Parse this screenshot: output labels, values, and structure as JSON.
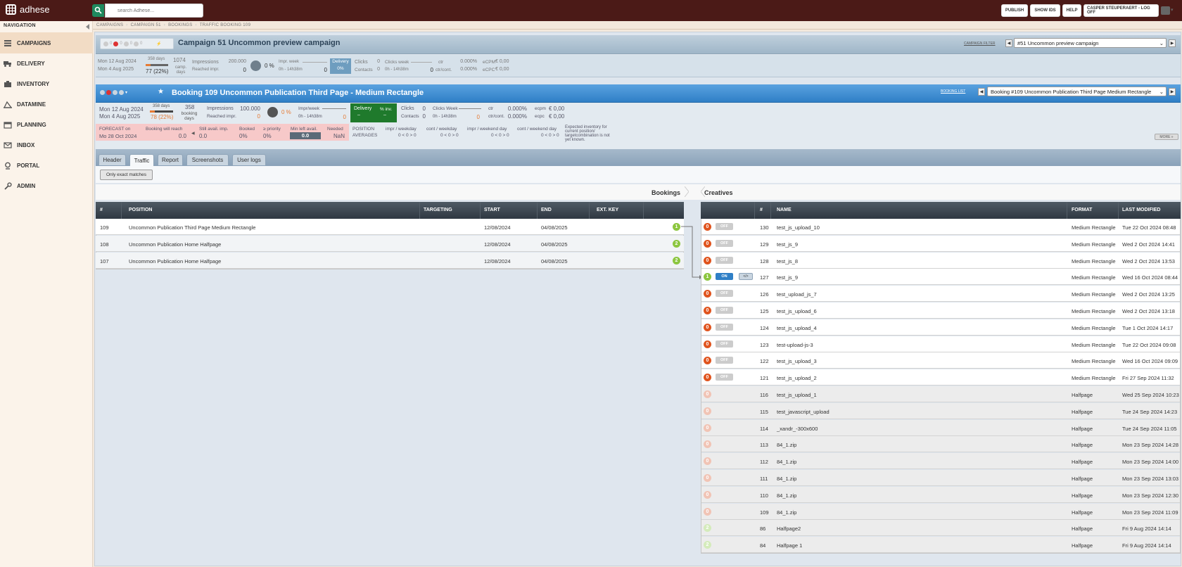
{
  "app": {
    "logo_text": "adhese",
    "search_placeholder": "search Adhese..."
  },
  "topbar": {
    "publish": "PUBLISH",
    "show_ids": "SHOW IDS",
    "help": "HELP",
    "user": "CASPER STEUPERAERT - LOG OFF"
  },
  "nav": {
    "title": "NAVIGATION",
    "items": [
      {
        "label": "CAMPAIGNS",
        "icon": "campaigns-icon"
      },
      {
        "label": "DELIVERY",
        "icon": "truck-icon"
      },
      {
        "label": "INVENTORY",
        "icon": "inventory-icon"
      },
      {
        "label": "DATAMINE",
        "icon": "datamine-icon"
      },
      {
        "label": "PLANNING",
        "icon": "calendar-icon"
      },
      {
        "label": "INBOX",
        "icon": "mail-icon"
      },
      {
        "label": "PORTAL",
        "icon": "portal-icon"
      },
      {
        "label": "ADMIN",
        "icon": "wrench-icon"
      }
    ]
  },
  "breadcrumb": [
    "CAMPAIGNS",
    "CAMPAIGN 51",
    "BOOKINGS",
    "TRAFFIC BOOKING 109"
  ],
  "campaign": {
    "status_counts": [
      "0",
      "0",
      "0",
      "0"
    ],
    "title": "Campaign 51   Uncommon preview campaign",
    "pub_link": "CAMPAIGN FILTER",
    "select": "#51 Uncommon preview campaign",
    "start": "Mon 12 Aug 2024",
    "end": "Mon 4 Aug 2025",
    "days": "358 days",
    "progress": "77 (22%)",
    "camp_days": "1074",
    "camp_days_label": "camp. days",
    "impressions_label": "Impressions",
    "impressions": "200.000",
    "reached_label": "Reached impr.",
    "reached": "0",
    "pct": "0 %",
    "impr_week_label": "Impr. week",
    "week_range": "0h - 14h38m",
    "impr_week": "0",
    "delivery_label": "Delivery",
    "delivery_pct": "0%",
    "clicks_label": "Clicks",
    "clicks": "0",
    "contacts_label": "Contacts",
    "contacts": "0",
    "clicks_week_label": "Clicks week",
    "clicks_week": "0",
    "ctr_label": "ctr",
    "ctr": "0.000%",
    "ctrcont_label": "ctr/cont.",
    "ctrcont": "0.000%",
    "ecpm_label": "eCPM",
    "ecpm": "€ 0,00",
    "ecpc_label": "eCPC",
    "ecpc": "€ 0,00"
  },
  "booking": {
    "title": "Booking 109   Uncommon Publication Third Page - Medium Rectangle",
    "list_link": "BOOKING LIST",
    "select": "Booking #109 Uncommon Publication Third Page Medium Rectangle",
    "start": "Mon 12 Aug 2024",
    "end": "Mon 4 Aug 2025",
    "days": "358 days",
    "progress": "78 (22%)",
    "booking_days": "358",
    "booking_days_label": "booking days",
    "impressions_label": "Impressions",
    "impressions": "100.000",
    "reached_label": "Reached impr.",
    "reached": "0",
    "pct": "0 %",
    "impr_week_label": "Impr/week",
    "week_range": "0h - 14h38m",
    "impr_week": "0",
    "delivery_label": "Delivery",
    "delivery_dash": "–",
    "inv_label": "% inv.",
    "inv_dash": "–",
    "clicks_label": "Clicks",
    "clicks": "0",
    "contacts_label": "Contacts",
    "contacts": "0",
    "clicks_week_label": "Clicks Week",
    "clicks_week": "0",
    "ctr_label": "ctr",
    "ctr": "0.000%",
    "ctrcont_label": "ctr/cont.",
    "ctrcont": "0.000%",
    "ecpm_label": "ecpm",
    "ecpm": "€ 0,00",
    "ecpc_label": "ecpc",
    "ecpc": "€ 0,00"
  },
  "forecast": {
    "label": "FORECAST on",
    "date": "Mo 28 Oct 2024",
    "will_reach_label": "Booking will reach",
    "will_reach": "0.0",
    "still_avail_label": "Still avail. imp.",
    "still_avail": "0.0",
    "booked_label": "Booked",
    "booked": "0%",
    "priority_label": "≥ priority",
    "priority": "0%",
    "min_left_label": "Min left avail.",
    "min_left": "0.0",
    "needed_label": "Needed",
    "needed": "NaN",
    "position_label": "POSITION",
    "averages_label": "AVERAGES",
    "impr_weekday_label": "impr / weekday",
    "impr_weekday": "0 < 0 > 0",
    "cont_weekday_label": "cont / weekday",
    "cont_weekday": "0 < 0 > 0",
    "impr_weekend_label": "impr / weekend day",
    "impr_weekend": "0 < 0 > 0",
    "cont_weekend_label": "cont / weekend day",
    "cont_weekend": "0 < 0 > 0",
    "note": "Expected inventory for current position/ targetcombination is not yet known.",
    "more": "MORE »"
  },
  "tabs": [
    "Header",
    "Traffic",
    "Report",
    "Screenshots",
    "User logs"
  ],
  "active_tab": "Traffic",
  "filter_button": "Only exact matches",
  "sections": {
    "bookings": "Bookings",
    "creatives": "Creatives"
  },
  "bookings_table": {
    "columns": [
      "#",
      "POSITION",
      "TARGETING",
      "START",
      "END",
      "EXT. KEY"
    ],
    "rows": [
      {
        "id": "109",
        "position": "Uncommon Publication Third Page Medium Rectangle",
        "targeting": "",
        "start": "12/08/2024",
        "end": "04/08/2025",
        "ext": "",
        "count": "1"
      },
      {
        "id": "108",
        "position": "Uncommon Publication Home Halfpage",
        "targeting": "",
        "start": "12/08/2024",
        "end": "04/08/2025",
        "ext": "",
        "count": "2"
      },
      {
        "id": "107",
        "position": "Uncommon Publication Home Halfpage",
        "targeting": "",
        "start": "12/08/2024",
        "end": "04/08/2025",
        "ext": "",
        "count": "2"
      }
    ]
  },
  "creatives_table": {
    "columns": [
      "#",
      "NAME",
      "FORMAT",
      "LAST MODIFIED"
    ],
    "rows": [
      {
        "badge": "0",
        "toggle": "OFF",
        "id": "130",
        "name": "test_js_upload_10",
        "format": "Medium Rectangle",
        "modified": "Tue 22 Oct 2024 08:48",
        "state": "off"
      },
      {
        "badge": "0",
        "toggle": "OFF",
        "id": "129",
        "name": "test_js_9",
        "format": "Medium Rectangle",
        "modified": "Wed 2 Oct 2024 14:41",
        "state": "off"
      },
      {
        "badge": "0",
        "toggle": "OFF",
        "id": "128",
        "name": "test_js_8",
        "format": "Medium Rectangle",
        "modified": "Wed 2 Oct 2024 13:53",
        "state": "off"
      },
      {
        "badge": "1",
        "toggle": "ON",
        "code": "</>",
        "id": "127",
        "name": "test_js_9",
        "format": "Medium Rectangle",
        "modified": "Wed 16 Oct 2024 08:44",
        "state": "on"
      },
      {
        "badge": "0",
        "toggle": "OFF",
        "id": "126",
        "name": "test_upload_js_7",
        "format": "Medium Rectangle",
        "modified": "Wed 2 Oct 2024 13:25",
        "state": "off"
      },
      {
        "badge": "0",
        "toggle": "OFF",
        "id": "125",
        "name": "test_js_upload_6",
        "format": "Medium Rectangle",
        "modified": "Wed 2 Oct 2024 13:18",
        "state": "off"
      },
      {
        "badge": "0",
        "toggle": "OFF",
        "id": "124",
        "name": "test_js_upload_4",
        "format": "Medium Rectangle",
        "modified": "Tue 1 Oct 2024 14:17",
        "state": "off"
      },
      {
        "badge": "0",
        "toggle": "OFF",
        "id": "123",
        "name": "test-upload-js-3",
        "format": "Medium Rectangle",
        "modified": "Tue 22 Oct 2024 09:08",
        "state": "off"
      },
      {
        "badge": "0",
        "toggle": "OFF",
        "id": "122",
        "name": "test_js_upload_3",
        "format": "Medium Rectangle",
        "modified": "Wed 16 Oct 2024 09:09",
        "state": "off"
      },
      {
        "badge": "0",
        "toggle": "OFF",
        "id": "121",
        "name": "test_js_upload_2",
        "format": "Medium Rectangle",
        "modified": "Fri 27 Sep 2024 11:32",
        "state": "off"
      },
      {
        "badge": "0",
        "id": "116",
        "name": "test_js_upload_1",
        "format": "Halfpage",
        "modified": "Wed 25 Sep 2024 10:23",
        "state": "na"
      },
      {
        "badge": "0",
        "id": "115",
        "name": "test_javascript_upload",
        "format": "Halfpage",
        "modified": "Tue 24 Sep 2024 14:23",
        "state": "na"
      },
      {
        "badge": "0",
        "id": "114",
        "name": "_xandr_-300x600",
        "format": "Halfpage",
        "modified": "Tue 24 Sep 2024 11:05",
        "state": "na"
      },
      {
        "badge": "0",
        "id": "113",
        "name": "84_1.zip",
        "format": "Halfpage",
        "modified": "Mon 23 Sep 2024 14:28",
        "state": "na"
      },
      {
        "badge": "0",
        "id": "112",
        "name": "84_1.zip",
        "format": "Halfpage",
        "modified": "Mon 23 Sep 2024 14:00",
        "state": "na"
      },
      {
        "badge": "0",
        "id": "111",
        "name": "84_1.zip",
        "format": "Halfpage",
        "modified": "Mon 23 Sep 2024 13:03",
        "state": "na"
      },
      {
        "badge": "0",
        "id": "110",
        "name": "84_1.zip",
        "format": "Halfpage",
        "modified": "Mon 23 Sep 2024 12:30",
        "state": "na"
      },
      {
        "badge": "0",
        "id": "109",
        "name": "84_1.zip",
        "format": "Halfpage",
        "modified": "Mon 23 Sep 2024 11:09",
        "state": "na"
      },
      {
        "badge": "2",
        "id": "86",
        "name": "Halfpage2",
        "format": "Halfpage",
        "modified": "Fri 9 Aug 2024 14:14",
        "state": "nag"
      },
      {
        "badge": "2",
        "id": "84",
        "name": "Halfpage 1",
        "format": "Halfpage",
        "modified": "Fri 9 Aug 2024 14:14",
        "state": "nag"
      }
    ]
  },
  "colors": {
    "topbar": "#4b1a17",
    "accent_green": "#8cc63f",
    "off_orange": "#e0541e",
    "on_blue": "#2f7fc6",
    "delivery_green": "#1f7a2c"
  }
}
